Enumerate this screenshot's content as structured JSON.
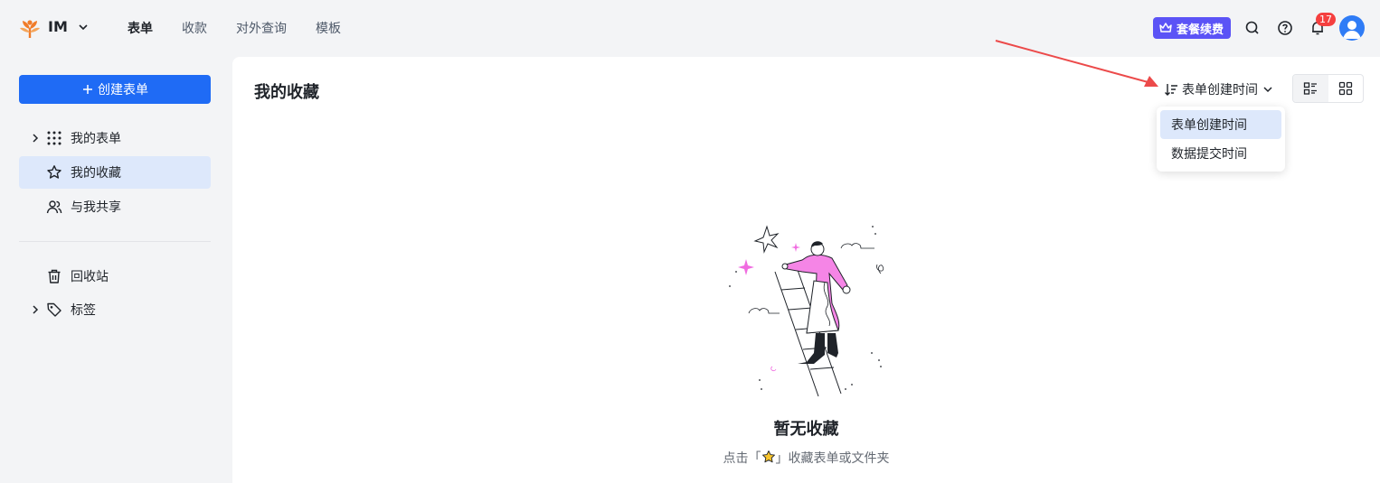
{
  "header": {
    "org_name": "IM",
    "nav": [
      {
        "label": "表单",
        "active": true
      },
      {
        "label": "收款",
        "active": false
      },
      {
        "label": "对外查询",
        "active": false
      },
      {
        "label": "模板",
        "active": false
      }
    ],
    "renew_label": "套餐续费",
    "notification_count": "17",
    "accent_color": "#5b53f6"
  },
  "sidebar": {
    "create_label": "创建表单",
    "items": [
      {
        "label": "我的表单",
        "icon": "grid-dots-icon",
        "expandable": true
      },
      {
        "label": "我的收藏",
        "icon": "star-icon",
        "active": true
      },
      {
        "label": "与我共享",
        "icon": "users-icon"
      },
      {
        "label": "回收站",
        "icon": "trash-icon"
      },
      {
        "label": "标签",
        "icon": "tag-icon",
        "expandable": true
      }
    ],
    "primary_color": "#1f6bf5"
  },
  "main": {
    "title": "我的收藏",
    "sort_label": "表单创建时间",
    "sort_options": [
      {
        "label": "表单创建时间",
        "selected": true
      },
      {
        "label": "数据提交时间",
        "selected": false
      }
    ],
    "empty_title": "暂无收藏",
    "empty_desc_prefix": "点击「",
    "empty_desc_suffix": "」收藏表单或文件夹"
  }
}
